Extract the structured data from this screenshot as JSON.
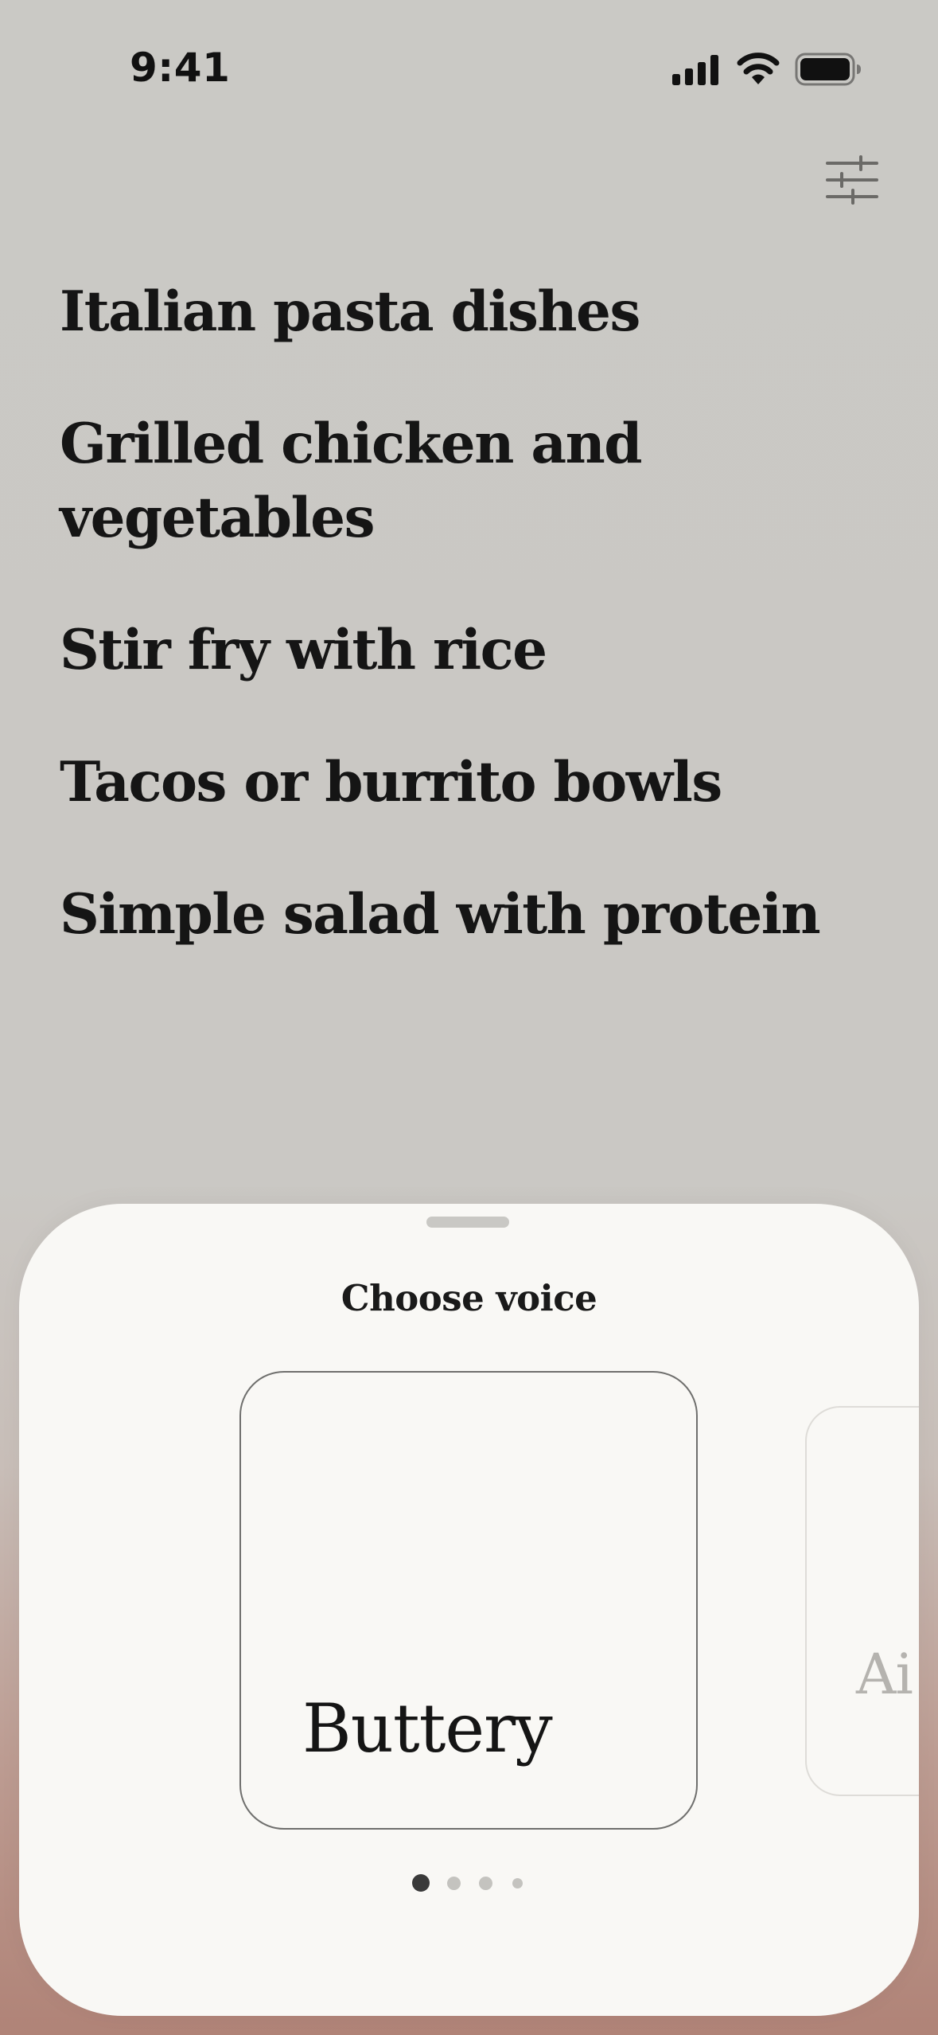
{
  "status_bar": {
    "time": "9:41",
    "icons": [
      "cellular-signal-icon",
      "wifi-icon",
      "battery-icon"
    ]
  },
  "toolbar": {
    "icon": "sliders-filter-icon"
  },
  "suggestions": [
    "Italian pasta dishes",
    "Grilled chicken and vegetables",
    "Stir fry with rice",
    "Tacos or burrito bowls",
    "Simple salad with protein"
  ],
  "voice_sheet": {
    "title": "Choose voice",
    "voices": [
      "Buttery",
      "Ai"
    ],
    "selected_index": 0,
    "page_count": 4,
    "current_page": 1
  },
  "colors": {
    "background_top": "#cac9c5",
    "background_bottom": "#b08377",
    "sheet": "#f9f8f5",
    "text": "#151515",
    "dot_active": "#3a3a3a",
    "dot_inactive": "#c4c3bf"
  }
}
